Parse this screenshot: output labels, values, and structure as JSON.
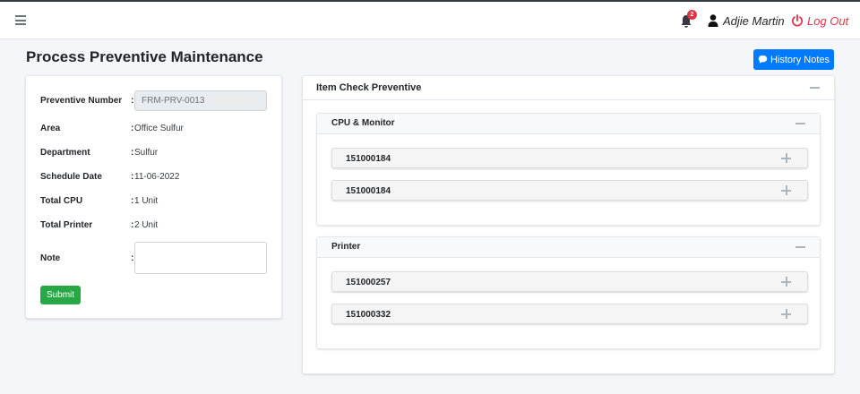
{
  "header": {
    "notification_count": "2",
    "user_name": "Adjie Martin",
    "logout_label": "Log Out",
    "icons": [
      "menu-icon",
      "bell-icon",
      "user-icon",
      "power-icon"
    ]
  },
  "page": {
    "title": "Process Preventive Maintenance",
    "history_button_label": "History Notes"
  },
  "form": {
    "fields": [
      {
        "label": "Preventive Number",
        "value": "FRM-PRV-0013"
      },
      {
        "label": "Area",
        "value": "Office Sulfur"
      },
      {
        "label": "Department",
        "value": "Sulfur"
      },
      {
        "label": "Schedule Date",
        "value": "11-06-2022"
      },
      {
        "label": "Total CPU",
        "value": "1 Unit"
      },
      {
        "label": "Total Printer",
        "value": "2 Unit"
      },
      {
        "label": "Note",
        "value": ""
      }
    ],
    "colon": ":",
    "submit_label": "Submit"
  },
  "items_panel": {
    "title": "Item Check Preventive",
    "groups": [
      {
        "title": "CPU & Monitor",
        "items": [
          "151000184",
          "151000184"
        ]
      },
      {
        "title": "Printer",
        "items": [
          "151000257",
          "151000332"
        ]
      }
    ]
  },
  "colors": {
    "primary": "#007bff",
    "success": "#28a745",
    "danger": "#dc3545",
    "background": "#f4f6f9"
  }
}
